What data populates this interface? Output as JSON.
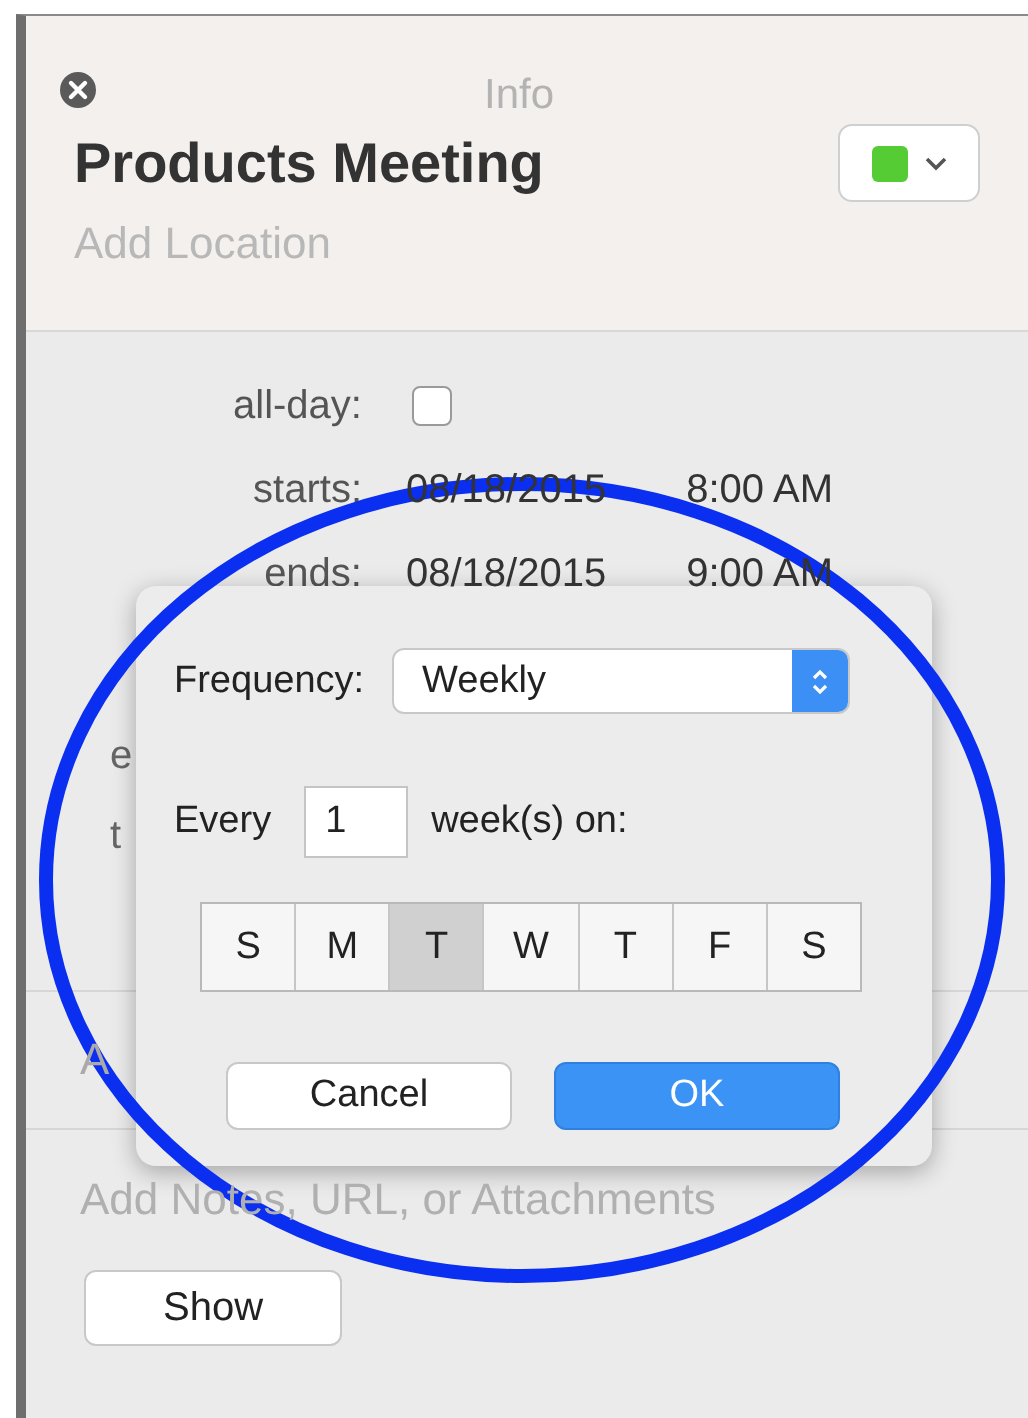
{
  "window": {
    "title": "Info"
  },
  "event": {
    "title": "Products Meeting",
    "location_placeholder": "Add Location"
  },
  "calendar": {
    "color": "#55cc33"
  },
  "all_day": {
    "label": "all-day:",
    "checked": false
  },
  "starts": {
    "label": "starts:",
    "date": "08/18/2015",
    "time": "8:00 AM"
  },
  "ends": {
    "label": "ends:",
    "date": "08/18/2015",
    "time": "9:00 AM"
  },
  "covered_rows": [
    "e",
    "t"
  ],
  "covered_section": "A",
  "notes_placeholder": "Add Notes, URL, or Attachments",
  "show_button": "Show",
  "repeat_popup": {
    "frequency_label": "Frequency:",
    "frequency": "Weekly",
    "every_label": "Every",
    "interval": "1",
    "unit_label": "week(s) on:",
    "days": [
      {
        "label": "S",
        "selected": false
      },
      {
        "label": "M",
        "selected": false
      },
      {
        "label": "T",
        "selected": true
      },
      {
        "label": "W",
        "selected": false
      },
      {
        "label": "T",
        "selected": false
      },
      {
        "label": "F",
        "selected": false
      },
      {
        "label": "S",
        "selected": false
      }
    ],
    "buttons": [
      {
        "label": "Cancel",
        "kind": "default"
      },
      {
        "label": "OK",
        "kind": "primary"
      }
    ]
  }
}
